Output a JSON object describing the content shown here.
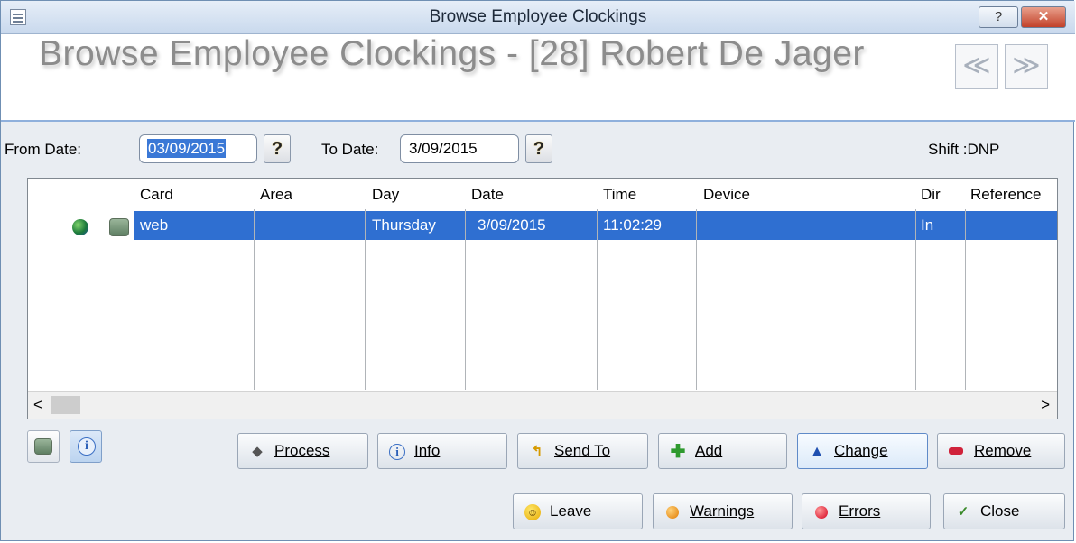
{
  "window": {
    "title": "Browse Employee Clockings",
    "help_label": "?",
    "close_label": "✕"
  },
  "header": {
    "big_title": "Browse Employee Clockings - [28] Robert De Jager",
    "prev_label": "≪",
    "next_label": "≫"
  },
  "filters": {
    "from_label": "From Date:",
    "from_value": "03/09/2015",
    "to_label": "To Date:",
    "to_value": "3/09/2015",
    "lookup_label": "?",
    "shift_text": "Shift :DNP"
  },
  "table": {
    "columns": [
      "Card",
      "Area",
      "Day",
      "Date",
      "Time",
      "Device",
      "Dir",
      "Reference"
    ],
    "rows": [
      {
        "card": "web",
        "area": "",
        "day": "Thursday",
        "date": "3/09/2015",
        "time": "11:02:29",
        "device": "",
        "dir": "In",
        "reference": ""
      }
    ],
    "scroll_left": "<",
    "scroll_right": ">"
  },
  "buttons": {
    "process": {
      "label": "Process",
      "icon": "eraser-icon"
    },
    "info": {
      "label": "Info",
      "icon": "info-icon"
    },
    "send_to": {
      "label": "Send To",
      "icon": "send-arrow-icon"
    },
    "add": {
      "label": "Add",
      "icon": "plus-icon"
    },
    "change": {
      "label": "Change",
      "icon": "triangle-icon"
    },
    "remove": {
      "label": "Remove",
      "icon": "minus-icon"
    },
    "leave": {
      "label": "Leave",
      "icon": "smiley-icon"
    },
    "warnings": {
      "label": "Warnings",
      "icon": "orange-dot-icon"
    },
    "errors": {
      "label": "Errors",
      "icon": "red-dot-icon"
    },
    "close": {
      "label": "Close",
      "icon": "checkmark-icon"
    }
  },
  "colors": {
    "selection": "#2f6fd1",
    "header_rule": "#8fb0dc",
    "title_text": "#8c8c8c"
  }
}
